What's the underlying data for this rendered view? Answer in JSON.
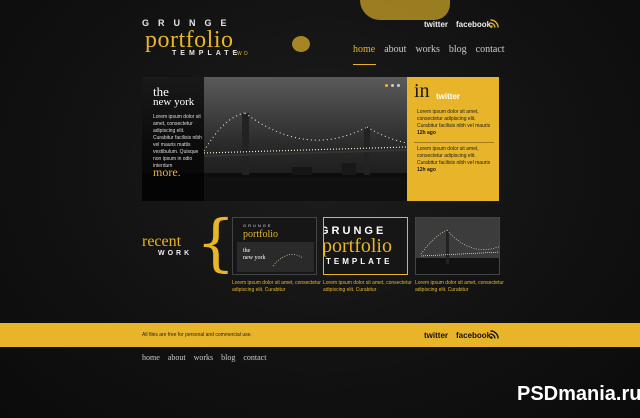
{
  "logo": {
    "line1": "GRUNGE",
    "line2": "portfolio",
    "line3": "TEMPLATE",
    "line3_suffix": "TWO"
  },
  "social": {
    "twitter": "twitter",
    "facebook": "facebook",
    "rss_icon": "rss-icon"
  },
  "nav": {
    "items": [
      "home",
      "about",
      "works",
      "blog",
      "contact"
    ],
    "active": "home"
  },
  "hero": {
    "title_line1": "the",
    "title_line2": "new york",
    "text": "Lorem ipsum dolor sit amet, consectetur adipiscing elit. Curabitur facilisis nibh vel mauris mattis vestibulum. Quisque non ipsum in odio interdum",
    "more": "more."
  },
  "twitter_panel": {
    "in": "in",
    "twitter": "twitter",
    "tweets": [
      {
        "text": "Lorem ipsum dolor sit amet, consectetur adipiscing elit. Curabitur facilisis nibh vel mauris",
        "date": "12h ago"
      },
      {
        "text": "Lorem ipsum dolor sit amet, consectetur adipiscing elit. Curabitur facilisis nibh vel mauris",
        "date": "12h ago"
      }
    ]
  },
  "recent": {
    "title": "recent",
    "subtitle": "WORK",
    "thumbs": [
      {
        "caption": "Lorem ipsum dolor sit amet, consectetur adipiscing elit. Curabitur"
      },
      {
        "caption": "Lorem ipsum dolor sit amet, consectetur adipiscing elit. Curabitur"
      },
      {
        "caption": "Lorem ipsum dolor sit amet, consectetur adipiscing elit. Curabitur"
      }
    ]
  },
  "footer": {
    "notice": "All files are free for personal and commercial use.",
    "twitter": "twitter",
    "facebook": "facebook",
    "nav": [
      "home",
      "about",
      "works",
      "blog",
      "contact"
    ]
  },
  "watermark": "PSDmania.ru",
  "colors": {
    "accent": "#e8b52a",
    "background": "#121212"
  }
}
